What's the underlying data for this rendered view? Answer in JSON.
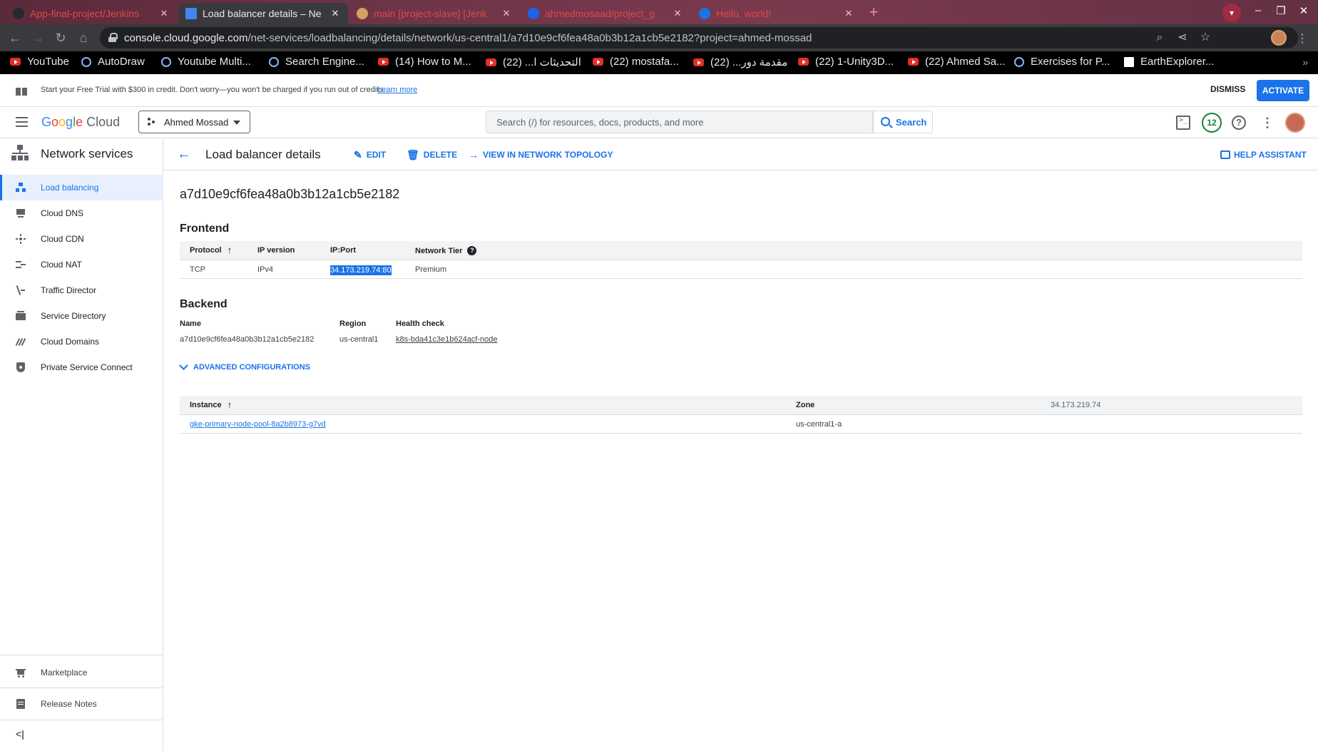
{
  "browser": {
    "tabs": [
      {
        "title": "App-final-project/Jenkins",
        "color": "#24292f"
      },
      {
        "title": "Load balancer details – Ne",
        "color": "#4285f4",
        "active": true
      },
      {
        "title": "main [project-slave] [Jenk",
        "color": "#d4a060"
      },
      {
        "title": "ahmedmosaad/project_g",
        "color": "#1d63ed"
      },
      {
        "title": "Hello, world!",
        "color": "#1a73e8"
      }
    ],
    "url_host": "console.cloud.google.com",
    "url_path": "/net-services/loadbalancing/details/network/us-central1/a7d10e9cf6fea48a0b3b12a1cb5e2182?project=ahmed-mossad",
    "bookmarks": [
      {
        "label": "YouTube",
        "kind": "youtube"
      },
      {
        "label": "AutoDraw",
        "kind": "generic"
      },
      {
        "label": "Youtube Multi...",
        "kind": "generic"
      },
      {
        "label": "Search Engine...",
        "kind": "generic"
      },
      {
        "label": "(14) How to M...",
        "kind": "youtube"
      },
      {
        "label": "التحديثات ا... (22)",
        "kind": "youtube"
      },
      {
        "label": "(22) mostafa...",
        "kind": "youtube"
      },
      {
        "label": "مقدمة دور... (22)",
        "kind": "youtube"
      },
      {
        "label": "(22) 1-Unity3D...",
        "kind": "youtube"
      },
      {
        "label": "(22) Ahmed Sa...",
        "kind": "youtube"
      },
      {
        "label": "Exercises for P...",
        "kind": "generic"
      },
      {
        "label": "EarthExplorer...",
        "kind": "ee"
      }
    ],
    "bookmarks_more": "»"
  },
  "banner": {
    "text": "Start your Free Trial with $300 in credit. Don't worry—you won't be charged if you run out of credits.",
    "link": "Learn more",
    "dismiss": "DISMISS",
    "activate": "ACTIVATE"
  },
  "header": {
    "logo_google": "Google",
    "logo_cloud": "Cloud",
    "project": "Ahmed Mossad",
    "search_placeholder": "Search (/) for resources, docs, products, and more",
    "search_button": "Search",
    "notifications": "12"
  },
  "sidebar": {
    "title": "Network services",
    "items": [
      {
        "label": "Load balancing",
        "icon": "load-balancing-icon",
        "active": true
      },
      {
        "label": "Cloud DNS",
        "icon": "dns-icon"
      },
      {
        "label": "Cloud CDN",
        "icon": "cdn-icon"
      },
      {
        "label": "Cloud NAT",
        "icon": "nat-icon"
      },
      {
        "label": "Traffic Director",
        "icon": "traffic-director-icon"
      },
      {
        "label": "Service Directory",
        "icon": "service-directory-icon"
      },
      {
        "label": "Cloud Domains",
        "icon": "domains-icon"
      },
      {
        "label": "Private Service Connect",
        "icon": "private-service-connect-icon"
      }
    ],
    "bottom_items": [
      {
        "label": "Marketplace",
        "icon": "marketplace-icon"
      },
      {
        "label": "Release Notes",
        "icon": "release-notes-icon"
      }
    ]
  },
  "page": {
    "title": "Load balancer details",
    "actions": {
      "edit": "EDIT",
      "delete": "DELETE",
      "topology": "VIEW IN NETWORK TOPOLOGY"
    },
    "help_assistant": "HELP ASSISTANT",
    "lb_name": "a7d10e9cf6fea48a0b3b12a1cb5e2182",
    "frontend": {
      "title": "Frontend",
      "columns": [
        "Protocol",
        "IP version",
        "IP:Port",
        "Network Tier"
      ],
      "row": {
        "protocol": "TCP",
        "ip_version": "IPv4",
        "ip_port": "34.173.219.74:80",
        "tier": "Premium"
      }
    },
    "backend": {
      "title": "Backend",
      "name_label": "Name",
      "name_value": "a7d10e9cf6fea48a0b3b12a1cb5e2182",
      "region_label": "Region",
      "region_value": "us-central1",
      "health_label": "Health check",
      "health_value": "k8s-bda41c3e1b624acf-node"
    },
    "advanced": "ADVANCED CONFIGURATIONS",
    "instances": {
      "columns": [
        "Instance",
        "Zone",
        "34.173.219.74"
      ],
      "row": {
        "instance": "gke-primary-node-pool-8a2b8973-g7vd",
        "zone": "us-central1-a"
      }
    }
  }
}
